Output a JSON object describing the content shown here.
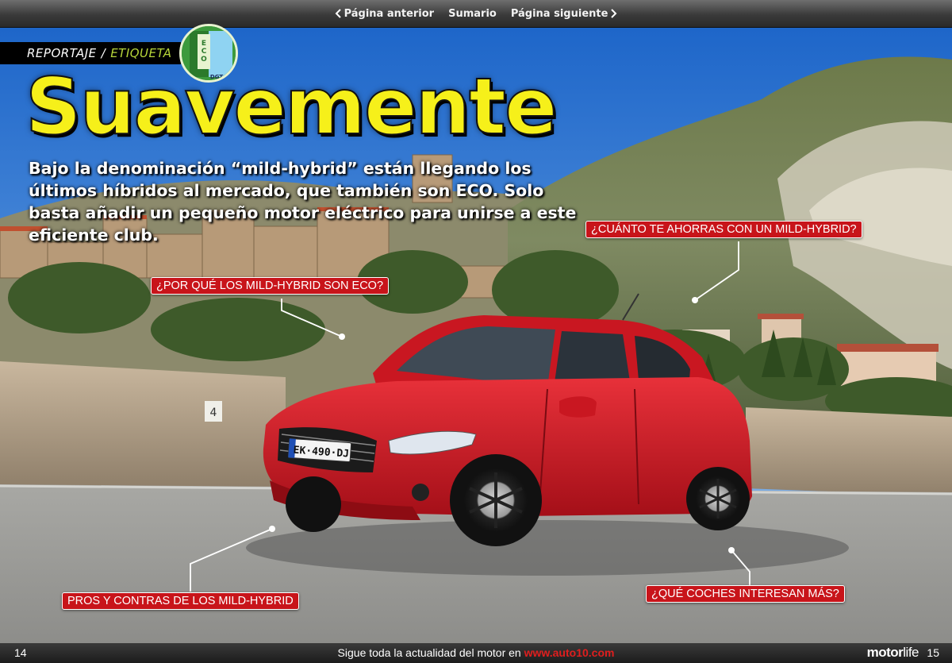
{
  "nav": {
    "prev_label": "Página anterior",
    "summary_label": "Sumario",
    "next_label": "Página siguiente"
  },
  "header": {
    "section": "REPORTAJE",
    "separator": "/",
    "subsection": "ETIQUETA",
    "badge": {
      "letters": "ECO",
      "caption": "DGT"
    }
  },
  "article": {
    "headline": "Suavemente",
    "lede": "Bajo la denominación “mild-hybrid” están llegando los últimos híbridos al mercado, que también son ECO. Solo basta añadir un pequeño motor eléctrico para unirse a este eficiente club."
  },
  "photo": {
    "license_plate": "EK·490·DJ"
  },
  "callouts": {
    "ahorro": "¿CUÁNTO TE AHORRAS CON UN MILD-HYBRID?",
    "por_que": "¿POR QUÉ LOS MILD-HYBRID SON ECO?",
    "pros_contras": "PROS Y CONTRAS DE LOS MILD-HYBRID",
    "que_coches": "¿QUÉ COCHES INTERESAN MÁS?"
  },
  "footer": {
    "page_left": "14",
    "tagline": "Sigue toda la actualidad del motor en",
    "url": "www.auto10.com",
    "brand_bold": "motor",
    "brand_light": "life",
    "page_right": "15"
  },
  "colors": {
    "headline": "#f6f01a",
    "callout": "#c8141a",
    "subsection": "#b7d63a",
    "car": "#d31a24"
  }
}
